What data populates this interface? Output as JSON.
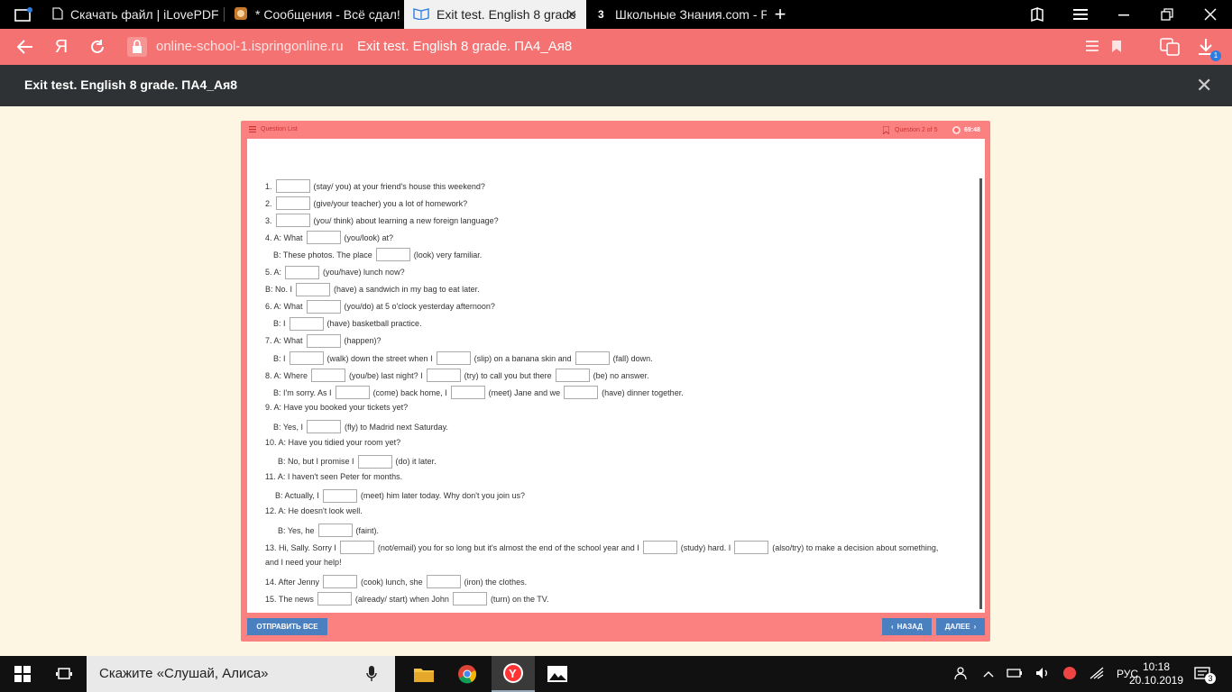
{
  "browser": {
    "tabs": [
      {
        "title": "Скачать файл | iLovePDF"
      },
      {
        "title": "* Сообщения - Всё сдал!"
      },
      {
        "title": "Exit test. English 8 grade"
      },
      {
        "title": "Школьные Знания.com - Р"
      }
    ],
    "address": {
      "domain": "online-school-1.ispringonline.ru",
      "page_title": "Exit test. English 8 grade. ПА4_Ая8"
    },
    "downloads_count": "1"
  },
  "header": {
    "title": "Exit test. English 8 grade. ПА4_Ая8"
  },
  "player": {
    "question_list_label": "Question List",
    "question_counter": "Question 2 of 5",
    "timer": "69:48",
    "submit_all": "ОТПРАВИТЬ ВСЕ",
    "back": "НАЗАД",
    "next": "ДАЛЕЕ"
  },
  "questions": [
    {
      "parts": [
        "1.",
        "",
        "(stay/ you) at your friend's house this weekend?"
      ]
    },
    {
      "parts": [
        "2.",
        "",
        "(give/your teacher) you a lot of homework?"
      ]
    },
    {
      "parts": [
        "3.",
        "",
        "(you/ think) about learning a new foreign language?"
      ]
    },
    {
      "parts": [
        "4. A: What",
        "",
        "(you/look) at?"
      ]
    },
    {
      "parts": [
        "B: These photos. The place",
        "",
        "(look) very familiar."
      ]
    },
    {
      "parts": [
        "5. A:",
        "",
        "(you/have) lunch now?"
      ]
    },
    {
      "parts": [
        "B: No. I",
        "",
        "(have) a sandwich in my bag to eat later."
      ]
    },
    {
      "parts": [
        "6. A: What",
        "",
        "(you/do) at 5 o'clock yesterday afternoon?"
      ]
    },
    {
      "parts": [
        "B: I",
        "",
        "(have) basketball practice."
      ]
    },
    {
      "parts": [
        "7. A: What",
        "",
        "(happen)?"
      ]
    },
    {
      "parts": [
        "B: I",
        "",
        "(walk) down the street when I",
        "",
        "(slip) on a banana skin and",
        "",
        "(fall) down."
      ]
    },
    {
      "parts": [
        "8. A: Where",
        "",
        "(you/be) last night? I",
        "",
        "(try) to call you but there",
        "",
        "(be) no answer."
      ]
    },
    {
      "parts": [
        "B: I'm sorry. As I",
        "",
        "(come) back home, I",
        "",
        "(meet) Jane and we",
        "",
        "(have) dinner together."
      ]
    },
    {
      "parts": [
        "9. A: Have you booked your tickets yet?"
      ]
    },
    {
      "parts": [
        "B: Yes, I",
        "",
        "(fly) to Madrid next Saturday."
      ]
    },
    {
      "parts": [
        "10. A: Have you tidied your room yet?"
      ]
    },
    {
      "parts": [
        "B: No, but I promise I",
        "",
        "(do) it later."
      ]
    },
    {
      "parts": [
        "11. A: I haven't seen Peter for months."
      ]
    },
    {
      "parts": [
        "B: Actually, I",
        "",
        "(meet) him later today. Why don't you join us?"
      ]
    },
    {
      "parts": [
        "12. A: He doesn't look well."
      ]
    },
    {
      "parts": [
        "B: Yes, he",
        "",
        "(faint)."
      ]
    },
    {
      "parts": [
        "13. Hi, Sally.  Sorry I",
        "",
        "(not/email) you for so long but it's almost the end of the school year and I",
        "",
        "(study) hard. I",
        "",
        "(also/try) to make a decision about something,"
      ]
    },
    {
      "parts": [
        "and I need your help!"
      ]
    },
    {
      "parts": [
        "14. After Jenny",
        "",
        "(cook) lunch, she",
        "",
        "(iron) the clothes."
      ]
    },
    {
      "parts": [
        "15. The news",
        "",
        "(already/ start) when John",
        "",
        "(turn) on the TV."
      ]
    }
  ],
  "taskbar": {
    "search_placeholder": "Скажите «Слушай, Алиса»",
    "language": "РУС",
    "time": "10:18",
    "date": "20.10.2019",
    "notifications": "3"
  }
}
